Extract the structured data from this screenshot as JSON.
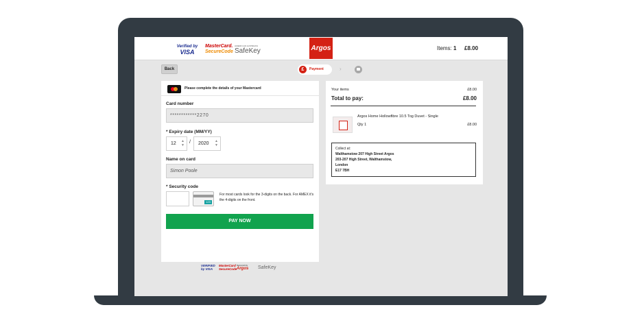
{
  "header": {
    "logos": {
      "verified_line1": "Verified by",
      "verified_line2": "VISA",
      "mastercard_line1": "MasterCard.",
      "mastercard_line2": "SecureCode",
      "safekey_line1": "AMERICAN EXPRESS",
      "safekey_line2": "SafeKey"
    },
    "brand": "Argos",
    "items_label": "Items:",
    "items_count": "1",
    "total": "£8.00"
  },
  "nav": {
    "back_label": "Back",
    "step1_symbol": "£",
    "step1_label": "Payment",
    "chevron": "›"
  },
  "payment_form": {
    "instruction": "Please complete the details of your Mastercard",
    "card_number_label": "Card number",
    "card_number_value": "************2270",
    "expiry_label": "* Expiry date (MM/YY)",
    "expiry_month": "12",
    "expiry_separator": "/",
    "expiry_year": "2020",
    "name_label": "Name on card",
    "name_value": "Simon Poole",
    "security_label": "* Security code",
    "cvv_card_digits": "123",
    "security_help": "For most cards look for the 3-digits on the back. For AMEX it's the 4-digits on the front.",
    "pay_button": "PAY NOW"
  },
  "footer_logos": {
    "verified": "VERIFIED by VISA",
    "mastercard": "MasterCard SecureCode",
    "argos_small": "Secured by",
    "argos": "Argos",
    "safekey": "SafeKey"
  },
  "summary": {
    "your_items_label": "Your items",
    "your_items_value": "£8.00",
    "total_label": "Total to pay:",
    "total_value": "£8.00",
    "product_name": "Argos Home Hollowfibre 10.5 Tog Duvet - Single",
    "product_qty": "Qty 1",
    "product_price": "£8.00",
    "collect_label": "Collect at:",
    "collect_lines": [
      "Walthamstow 207 High Street Argos",
      "203-207 High Street, Walthamstow,",
      "London",
      "E17 7BH"
    ]
  },
  "colors": {
    "argos_red": "#d42114",
    "pay_green": "#11a34e",
    "laptop_frame": "#323b43"
  }
}
